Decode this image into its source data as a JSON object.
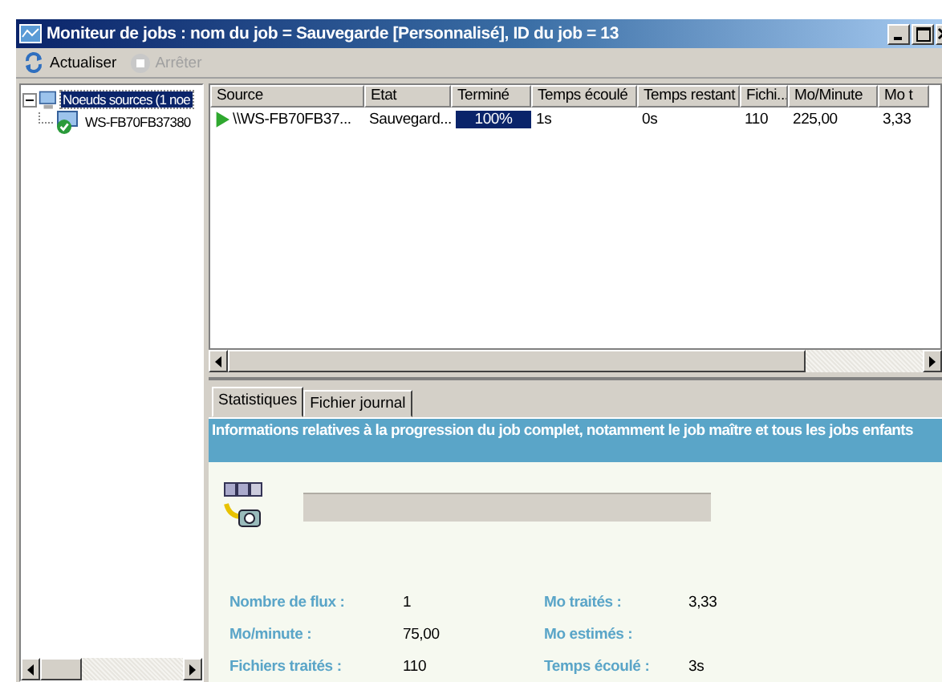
{
  "window": {
    "title": "Moniteur de jobs : nom du job = Sauvegarde [Personnalisé], ID du job = 13"
  },
  "toolbar": [
    {
      "label": "Actualiser",
      "disabled": false
    },
    {
      "label": "Arrêter",
      "disabled": true
    }
  ],
  "tree": [
    {
      "label": "Noeuds sources (1 noe",
      "selected": true,
      "expanded": true,
      "children": [
        {
          "label": "WS-FB70FB37380",
          "selected": false
        }
      ]
    }
  ],
  "table": {
    "columns": [
      "Source",
      "Etat",
      "Terminé",
      "Temps écoulé",
      "Temps restant",
      "Fichi...",
      "Mo/Minute",
      "Mo t"
    ],
    "rows": [
      {
        "source": "\\\\WS-FB70FB37...",
        "etat": "Sauvegard...",
        "termine": "100%",
        "level": 1,
        "temps_ecoule": "1s",
        "temps_restant": "0s",
        "fichiers": "110",
        "mo_minute": "225,00",
        "column_8": "3,33"
      }
    ]
  },
  "tabs": [
    {
      "label": "Statistiques",
      "selected": true
    },
    {
      "label": "Fichier journal",
      "selected": false
    }
  ],
  "banner": "Informations relatives à la progression du job complet, notamment le job maître et tous les jobs enfants",
  "progress": {
    "level": 0
  },
  "stats": [
    {
      "label": "Nombre de flux :",
      "value": "1"
    },
    {
      "label": "Mo traités :",
      "value": "3,33"
    },
    {
      "label": "Mo/minute :",
      "value": "75,00"
    },
    {
      "label": "Mo estimés :"
    },
    {
      "label": "Fichiers traités :",
      "value": "110"
    },
    {
      "label": "Temps écoulé :",
      "value": "3s"
    }
  ]
}
